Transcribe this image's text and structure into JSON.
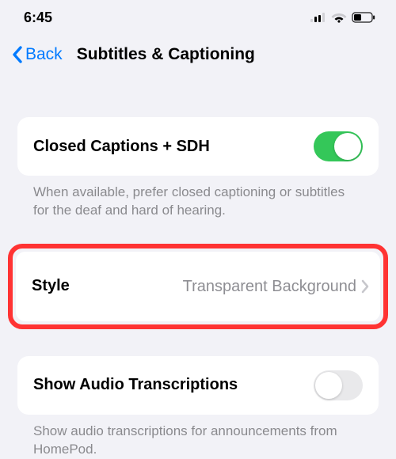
{
  "status": {
    "time": "6:45"
  },
  "nav": {
    "back_label": "Back",
    "title": "Subtitles & Captioning"
  },
  "closed_captions": {
    "label": "Closed Captions + SDH",
    "enabled": true,
    "footer": "When available, prefer closed captioning or subtitles for the deaf and hard of hearing."
  },
  "style": {
    "label": "Style",
    "value": "Transparent Background"
  },
  "audio_transcriptions": {
    "label": "Show Audio Transcriptions",
    "enabled": false,
    "footer": "Show audio transcriptions for announcements from HomePod."
  }
}
